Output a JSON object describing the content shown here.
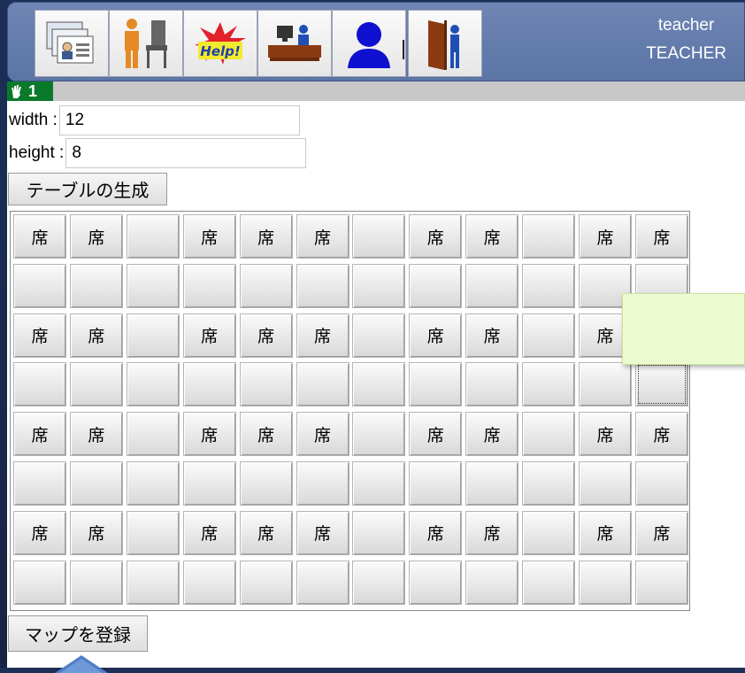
{
  "toolbar": {
    "icons": [
      "id-cards-icon",
      "person-chair-icon",
      "help-icon",
      "teacher-desk-icon",
      "user-silhouette-icon",
      "exit-door-icon"
    ],
    "help_text": "Help!"
  },
  "user": {
    "name": "teacher",
    "role": "TEACHER"
  },
  "status": {
    "hand_count": "1"
  },
  "form": {
    "width_label": "width :",
    "width_value": "12",
    "height_label": "height :",
    "height_value": "8",
    "generate_button": "テーブルの生成",
    "register_button": "マップを登録"
  },
  "grid": {
    "seat_label": "席",
    "columns": 12,
    "rows": [
      [
        1,
        1,
        0,
        1,
        1,
        1,
        0,
        1,
        1,
        0,
        1,
        1
      ],
      [
        0,
        0,
        0,
        0,
        0,
        0,
        0,
        0,
        0,
        0,
        0,
        0
      ],
      [
        1,
        1,
        0,
        1,
        1,
        1,
        0,
        1,
        1,
        0,
        1,
        1
      ],
      [
        0,
        0,
        0,
        0,
        0,
        0,
        0,
        0,
        0,
        0,
        0,
        0
      ],
      [
        1,
        1,
        0,
        1,
        1,
        1,
        0,
        1,
        1,
        0,
        1,
        1
      ],
      [
        0,
        0,
        0,
        0,
        0,
        0,
        0,
        0,
        0,
        0,
        0,
        0
      ],
      [
        1,
        1,
        0,
        1,
        1,
        1,
        0,
        1,
        1,
        0,
        1,
        1
      ],
      [
        0,
        0,
        0,
        0,
        0,
        0,
        0,
        0,
        0,
        0,
        0,
        0
      ]
    ],
    "focused_cell": {
      "row": 3,
      "col": 11
    }
  },
  "colors": {
    "toolbar": "#6f86b4",
    "badge": "#0a7a2a",
    "tooltip": "#ecfbcf",
    "pointer": "#4f7ec9"
  }
}
